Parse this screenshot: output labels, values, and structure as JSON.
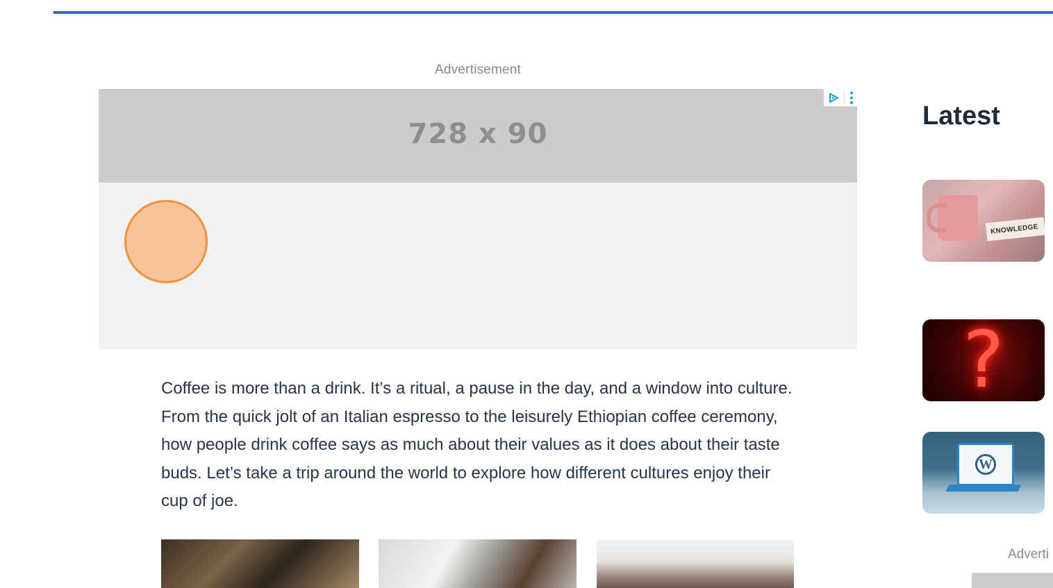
{
  "main": {
    "ad_label": "Advertisement",
    "ad_size_text": "728 x 90",
    "article_paragraph": "Coffee is more than a drink. It’s a ritual, a pause in the day, and a window into culture. From the quick jolt of an Italian espresso to the leisurely Ethiopian coffee ceremony, how people drink coffee says as much about their values as it does about their taste buds. Let’s take a trip around the world to explore how different cultures enjoy their cup of joe."
  },
  "sidebar": {
    "title": "Latest",
    "items": [
      {
        "image_icon": "coffee-mug-book-image",
        "image_text": "KNOWLEDGE"
      },
      {
        "image_icon": "neon-question-mark-image",
        "image_text": "?"
      },
      {
        "image_icon": "wordpress-laptop-image",
        "image_text": "W"
      }
    ],
    "ad_label": "Adverti"
  },
  "colors": {
    "accent_rule": "#3a66c4",
    "ad_banner": "#cccccc",
    "ad_background": "#f1f1f1",
    "cursor_fill": "#f7c399",
    "cursor_stroke": "#f3913e",
    "text": "#263548"
  },
  "icons": {
    "ad_choices": "ad-choices-icon",
    "ad_menu": "ad-menu-dots-icon"
  }
}
